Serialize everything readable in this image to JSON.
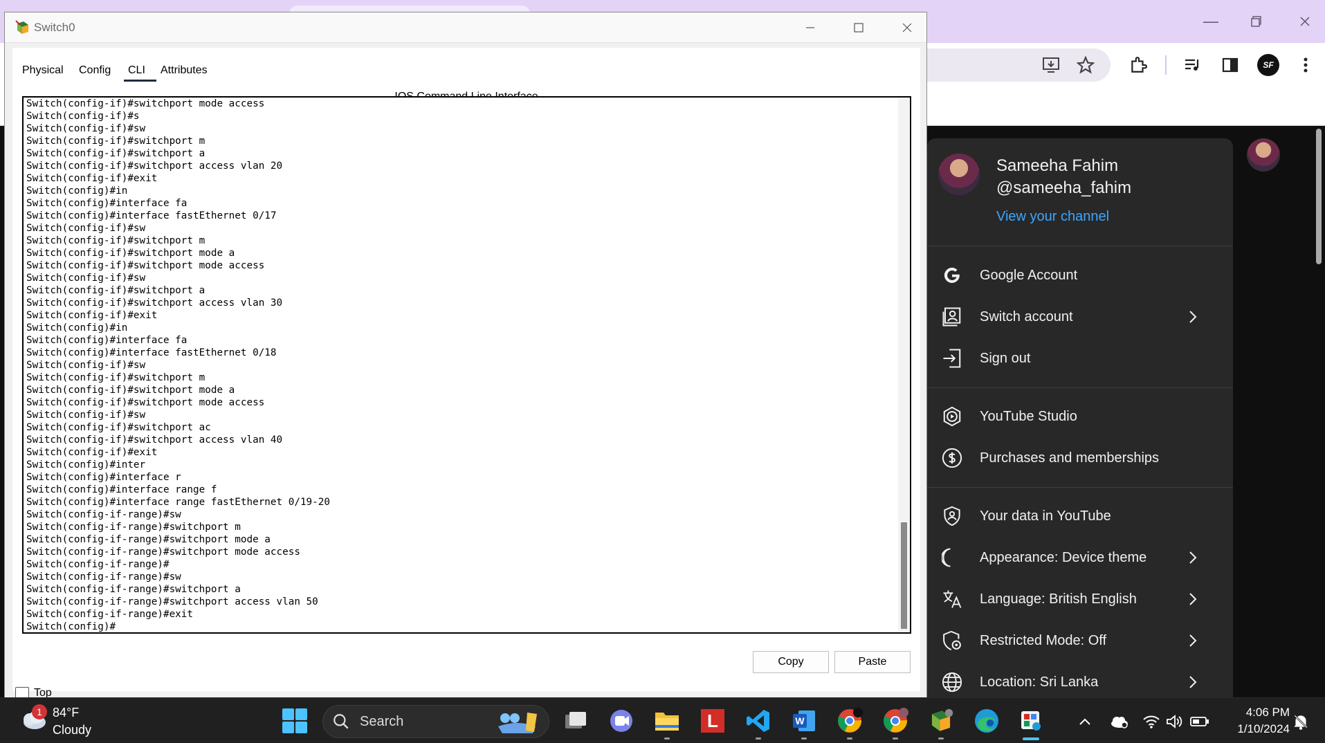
{
  "browser": {
    "window_controls": [
      "minimize",
      "restore",
      "close"
    ],
    "toolbar_icons": [
      "install-app-icon",
      "bookmark-star-icon",
      "extensions-icon",
      "media-controls-icon",
      "side-panel-icon",
      "profile-icon",
      "menu-icon"
    ],
    "profile_initials": "SF"
  },
  "youtube_menu": {
    "name": "Sameeha Fahim",
    "handle": "@sameeha_fahim",
    "view_channel": "View your channel",
    "items": [
      {
        "label": "Google Account",
        "icon": "google-icon",
        "has_chevron": false
      },
      {
        "label": "Switch account",
        "icon": "switch-account-icon",
        "has_chevron": true
      },
      {
        "label": "Sign out",
        "icon": "sign-out-icon",
        "has_chevron": false
      },
      {
        "label": "YouTube Studio",
        "icon": "youtube-studio-icon",
        "has_chevron": false
      },
      {
        "label": "Purchases and memberships",
        "icon": "dollar-icon",
        "has_chevron": false
      },
      {
        "label": "Your data in YouTube",
        "icon": "shield-person-icon",
        "has_chevron": false
      },
      {
        "label": "Appearance: Device theme",
        "icon": "moon-icon",
        "has_chevron": true
      },
      {
        "label": "Language: British English",
        "icon": "translate-icon",
        "has_chevron": true
      },
      {
        "label": "Restricted Mode: Off",
        "icon": "restricted-mode-icon",
        "has_chevron": true
      },
      {
        "label": "Location: Sri Lanka",
        "icon": "globe-icon",
        "has_chevron": true
      }
    ]
  },
  "pt_window": {
    "title": "Switch0",
    "tabs": [
      {
        "label": "Physical",
        "active": false
      },
      {
        "label": "Config",
        "active": false
      },
      {
        "label": "CLI",
        "active": true
      },
      {
        "label": "Attributes",
        "active": false
      }
    ],
    "cli_heading": "IOS Command Line Interface",
    "cli_lines": [
      "Switch(config-if)#switchport mode access",
      "Switch(config-if)#s",
      "Switch(config-if)#sw",
      "Switch(config-if)#switchport m",
      "Switch(config-if)#switchport a",
      "Switch(config-if)#switchport access vlan 20",
      "Switch(config-if)#exit",
      "Switch(config)#in",
      "Switch(config)#interface fa",
      "Switch(config)#interface fastEthernet 0/17",
      "Switch(config-if)#sw",
      "Switch(config-if)#switchport m",
      "Switch(config-if)#switchport mode a",
      "Switch(config-if)#switchport mode access",
      "Switch(config-if)#sw",
      "Switch(config-if)#switchport a",
      "Switch(config-if)#switchport access vlan 30",
      "Switch(config-if)#exit",
      "Switch(config)#in",
      "Switch(config)#interface fa",
      "Switch(config)#interface fastEthernet 0/18",
      "Switch(config-if)#sw",
      "Switch(config-if)#switchport m",
      "Switch(config-if)#switchport mode a",
      "Switch(config-if)#switchport mode access",
      "Switch(config-if)#sw",
      "Switch(config-if)#switchport ac",
      "Switch(config-if)#switchport access vlan 40",
      "Switch(config-if)#exit",
      "Switch(config)#inter",
      "Switch(config)#interface r",
      "Switch(config)#interface range f",
      "Switch(config)#interface range fastEthernet 0/19-20",
      "Switch(config-if-range)#sw",
      "Switch(config-if-range)#switchport m",
      "Switch(config-if-range)#switchport mode a",
      "Switch(config-if-range)#switchport mode access",
      "Switch(config-if-range)#",
      "Switch(config-if-range)#sw",
      "Switch(config-if-range)#switchport a",
      "Switch(config-if-range)#switchport access vlan 50",
      "Switch(config-if-range)#exit",
      "Switch(config)#"
    ],
    "copy_label": "Copy",
    "paste_label": "Paste",
    "top_label": "Top",
    "top_checked": false
  },
  "taskbar": {
    "weather": {
      "badge": "1",
      "temp": "84°F",
      "condition": "Cloudy"
    },
    "search_label": "Search",
    "apps": [
      "start-icon",
      "task-view-icon",
      "teams-icon",
      "file-explorer-icon",
      "lastpass-icon",
      "vscode-icon",
      "word-icon",
      "chrome-icon",
      "chrome-profile-icon",
      "packet-tracer-icon",
      "edge-icon",
      "packet-tracer-active-icon"
    ],
    "time": "4:06 PM",
    "date": "1/10/2024"
  }
}
